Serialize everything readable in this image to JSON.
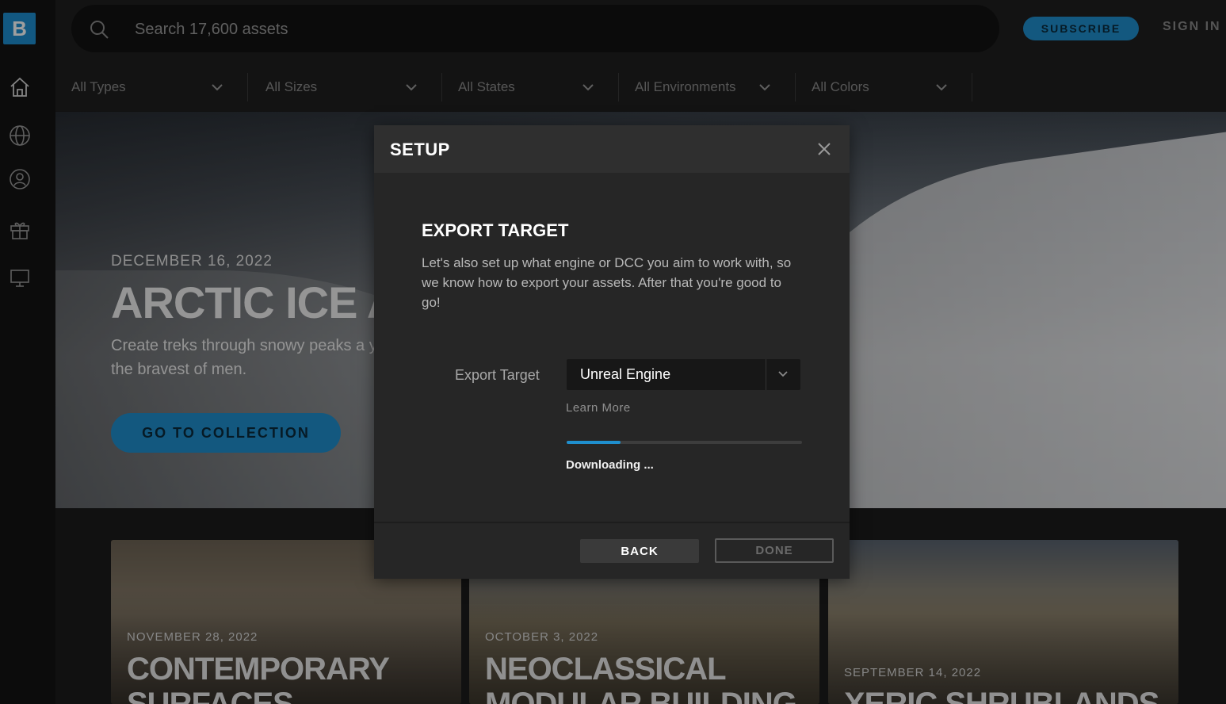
{
  "sidebar": {
    "logo": "B",
    "items": [
      {
        "name": "home",
        "icon": "home-icon"
      },
      {
        "name": "globe",
        "icon": "globe-icon"
      },
      {
        "name": "profile",
        "icon": "user-circle-icon"
      },
      {
        "name": "gift",
        "icon": "gift-icon"
      },
      {
        "name": "screen",
        "icon": "monitor-icon"
      }
    ]
  },
  "header": {
    "search_placeholder": "Search 17,600 assets",
    "subscribe_label": "SUBSCRIBE",
    "signin_label": "SIGN IN"
  },
  "filters": [
    {
      "label": "All Types"
    },
    {
      "label": "All Sizes"
    },
    {
      "label": "All States"
    },
    {
      "label": "All Environments"
    },
    {
      "label": "All Colors"
    }
  ],
  "hero": {
    "date": "DECEMBER 16, 2022",
    "title": "ARCTIC ICE AND",
    "description": "Create treks through snowy peaks a yetis and the bravest of men.",
    "cta": "GO TO COLLECTION"
  },
  "cards": [
    {
      "date": "NOVEMBER 28, 2022",
      "title_line1": "CONTEMPORARY",
      "title_line2": "SURFACES"
    },
    {
      "date": "OCTOBER 3, 2022",
      "title_line1": "NEOCLASSICAL",
      "title_line2": "MODULAR BUILDING"
    },
    {
      "date": "SEPTEMBER 14, 2022",
      "title_line1": "XERIC SHRUBLANDS",
      "title_line2": ""
    }
  ],
  "modal": {
    "title": "SETUP",
    "section_title": "EXPORT TARGET",
    "description": "Let's also set up what engine or DCC you aim to work with, so we know how to export your assets. After that you're good to go!",
    "field_label": "Export Target",
    "selected_value": "Unreal Engine",
    "learn_more": "Learn More",
    "progress": 0.23,
    "status": "Downloading ...",
    "back_label": "BACK",
    "done_label": "DONE"
  },
  "colors": {
    "accent": "#1f8fce",
    "background": "#1c1c1c",
    "modal": "#262626"
  }
}
